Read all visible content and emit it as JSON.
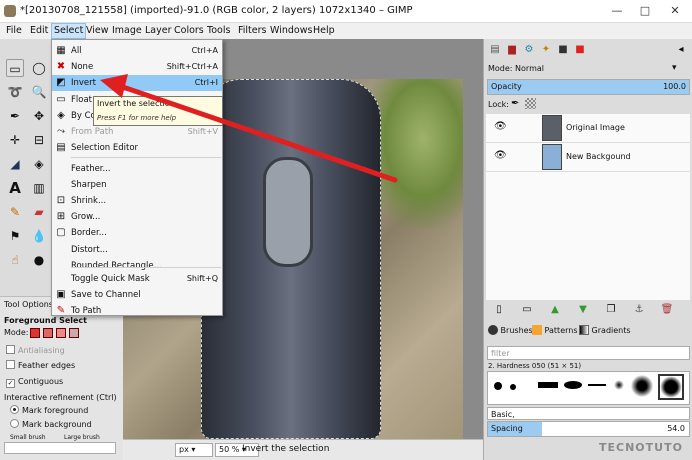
{
  "window": {
    "title": "*[20130708_121558] (imported)-91.0 (RGB color, 2 layers) 1072x1340 – GIMP",
    "minimize": "—",
    "maximize": "□",
    "close": "✕"
  },
  "menubar": [
    "File",
    "Edit",
    "Select",
    "View",
    "Image",
    "Layer",
    "Colors",
    "Tools",
    "Filters",
    "Windows",
    "Help"
  ],
  "select_menu": {
    "items": [
      {
        "label": "All",
        "shortcut": "Ctrl+A",
        "icon": "select-all-icon",
        "glyph": "▦"
      },
      {
        "label": "None",
        "shortcut": "Shift+Ctrl+A",
        "icon": "select-none-icon",
        "glyph": "✖"
      },
      {
        "label": "Invert",
        "shortcut": "Ctrl+I",
        "icon": "invert-icon",
        "glyph": "◩",
        "highlighted": true
      },
      {
        "label": "Float",
        "shortcut": "Shift+Ctrl+L",
        "icon": "float-icon",
        "glyph": "▭"
      },
      {
        "label": "By Color",
        "shortcut": "Shift+O",
        "icon": "by-color-icon",
        "glyph": "◈"
      },
      {
        "label": "From Path",
        "shortcut": "Shift+V",
        "icon": "from-path-icon",
        "glyph": "⤳",
        "disabled": true
      },
      {
        "label": "Selection Editor",
        "shortcut": "",
        "icon": "selection-editor-icon",
        "glyph": "▤"
      },
      {
        "label": "Feather...",
        "shortcut": "",
        "icon": "",
        "glyph": ""
      },
      {
        "label": "Sharpen",
        "shortcut": "",
        "icon": "",
        "glyph": ""
      },
      {
        "label": "Shrink...",
        "shortcut": "",
        "icon": "shrink-icon",
        "glyph": "⊡"
      },
      {
        "label": "Grow...",
        "shortcut": "",
        "icon": "grow-icon",
        "glyph": "⊞"
      },
      {
        "label": "Border...",
        "shortcut": "",
        "icon": "border-icon",
        "glyph": "▢"
      },
      {
        "label": "Distort...",
        "shortcut": "",
        "icon": "",
        "glyph": ""
      },
      {
        "label": "Rounded Rectangle...",
        "shortcut": "",
        "icon": "",
        "glyph": ""
      },
      {
        "label": "Toggle Quick Mask",
        "shortcut": "Shift+Q",
        "icon": "",
        "glyph": ""
      },
      {
        "label": "Save to Channel",
        "shortcut": "",
        "icon": "save-channel-icon",
        "glyph": "▣"
      },
      {
        "label": "To Path",
        "shortcut": "",
        "icon": "to-path-icon",
        "glyph": "✎"
      }
    ]
  },
  "tooltip": {
    "text": "Invert the selection",
    "hint": "Press F1 for more help"
  },
  "tool_options": {
    "tab": "Tool Options",
    "title": "Foreground Select",
    "mode_label": "Mode:",
    "antialiasing": "Antialiasing",
    "feather_edges": "Feather edges",
    "contiguous": "Contiguous",
    "refinement_label": "Interactive refinement (Ctrl)",
    "mark_fg": "Mark foreground",
    "mark_bg": "Mark background",
    "small_brush": "Small brush",
    "large_brush": "Large brush"
  },
  "statusbar": {
    "unit": "px",
    "zoom": "50 %",
    "message": "Invert the selection"
  },
  "layers_dock": {
    "mode_label": "Mode:",
    "mode_value": "Normal",
    "opacity_label": "Opacity",
    "opacity_value": "100.0",
    "opacity_fraction": 1.0,
    "lock_label": "Lock:",
    "layers": [
      {
        "name": "Original Image",
        "thumb_color": "#5b5f68"
      },
      {
        "name": "New Backgound",
        "thumb_color": "#8ab0d8"
      }
    ]
  },
  "brushes_dock": {
    "tabs": [
      "Brushes",
      "Patterns",
      "Gradients"
    ],
    "filter_placeholder": "filter",
    "current": "2. Hardness 050 (51 × 51)",
    "tag": "Basic,",
    "spacing_label": "Spacing",
    "spacing_value": "54.0",
    "spacing_fraction": 0.27
  },
  "watermark": "TECNOTUTO"
}
